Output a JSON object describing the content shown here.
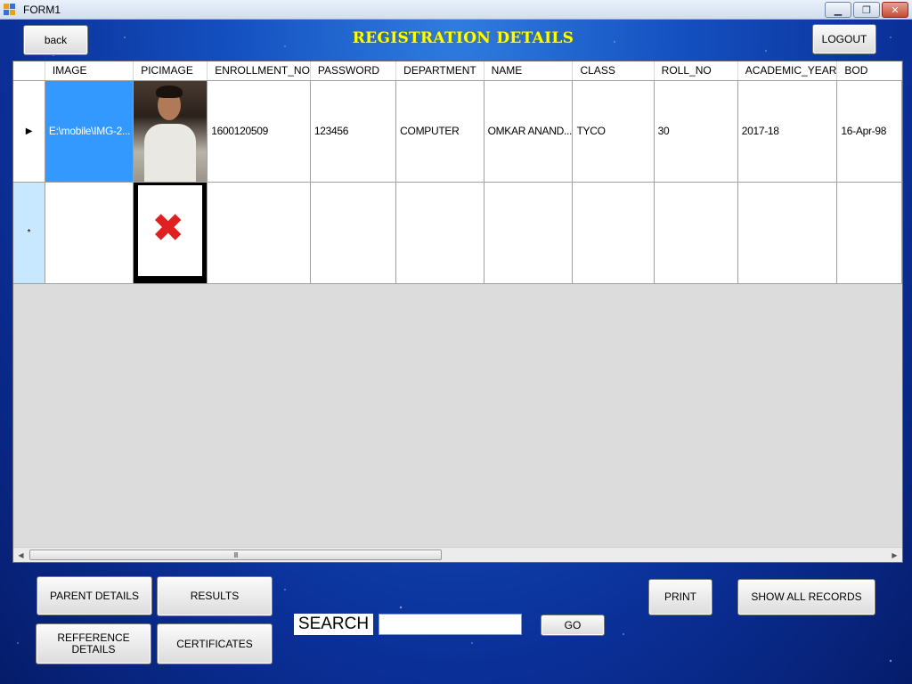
{
  "window": {
    "title": "FORM1"
  },
  "header": {
    "back_label": "back",
    "title": "REGISTRATION DETAILS",
    "logout_label": "LOGOUT"
  },
  "grid": {
    "columns": [
      "IMAGE",
      "PICIMAGE",
      "ENROLLMENT_NO",
      "PASSWORD",
      "DEPARTMENT",
      "NAME",
      "CLASS",
      "ROLL_NO",
      "ACADEMIC_YEAR",
      "BOD"
    ],
    "rows": [
      {
        "image": "E:\\mobile\\IMG-2...",
        "enrollment_no": "1600120509",
        "password": "123456",
        "department": "COMPUTER",
        "name": "OMKAR ANAND...",
        "class": "TYCO",
        "roll_no": "30",
        "academic_year": "2017-18",
        "bod": "16-Apr-98"
      }
    ],
    "row_indicators": {
      "current": "▶",
      "new": "*"
    },
    "scrollbar_grip": "III"
  },
  "buttons": {
    "parent_details": "PARENT DETAILS",
    "results": "RESULTS",
    "refference_details": "REFFERENCE DETAILS",
    "certificates": "CERTIFICATES",
    "print": "PRINT",
    "show_all_records": "SHOW ALL RECORDS",
    "go": "GO"
  },
  "search": {
    "label": "SEARCH",
    "value": "",
    "placeholder": ""
  },
  "icons": [
    "app-icon",
    "minimize-icon",
    "restore-icon",
    "close-icon",
    "row-pointer-icon",
    "new-row-icon",
    "broken-image-icon",
    "scroll-left-icon",
    "scroll-right-icon"
  ]
}
